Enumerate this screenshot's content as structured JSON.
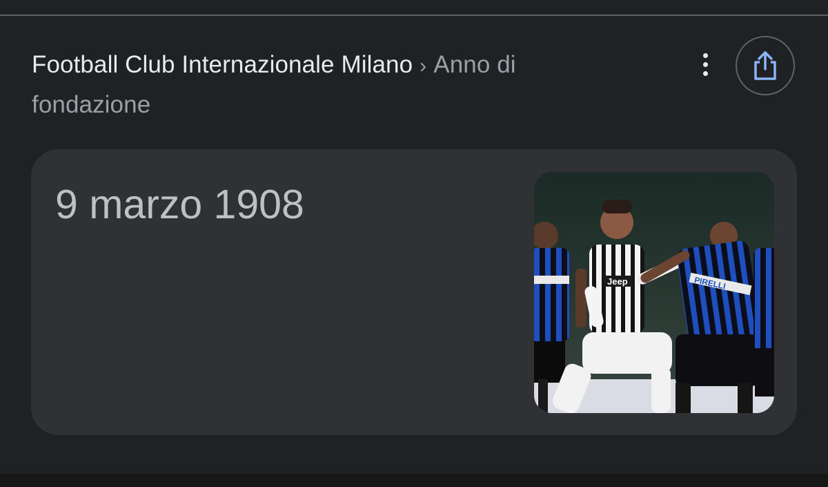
{
  "breadcrumb": {
    "entity": "Football Club Internazionale Milano",
    "separator": "›",
    "attribute": "Anno di fondazione"
  },
  "actions": {
    "more_icon": "more-vert-icon",
    "share_icon": "share-icon"
  },
  "answer_card": {
    "value": "9 marzo 1908",
    "image": {
      "jersey_text_main": "Jeep",
      "jersey_text_stripes": "PIRELLI"
    }
  },
  "colors": {
    "background": "#202124",
    "card": "#303134",
    "primary_text": "#e8eaed",
    "secondary_text": "#9aa0a6",
    "share_icon": "#8ab4f8"
  }
}
